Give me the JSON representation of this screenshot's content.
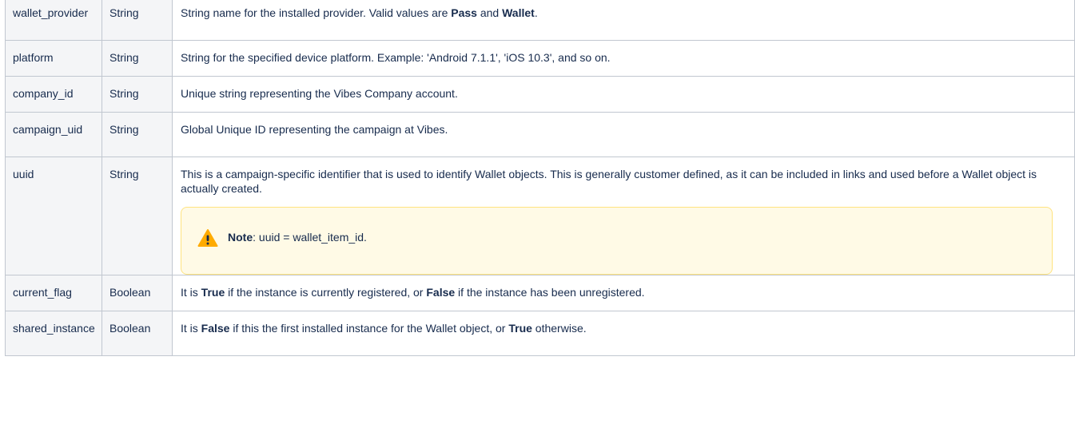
{
  "rows": [
    {
      "name": "wallet_provider",
      "type": "String",
      "desc": [
        {
          "text": "String name for the installed provider. Valid values are "
        },
        {
          "text": "Pass",
          "bold": true
        },
        {
          "text": " and "
        },
        {
          "text": "Wallet",
          "bold": true
        },
        {
          "text": "."
        }
      ]
    },
    {
      "name": "platform",
      "type": "String",
      "desc": [
        {
          "text": "String for the specified device platform. Example: 'Android 7.1.1', 'iOS 10.3', and so on."
        }
      ]
    },
    {
      "name": "company_id",
      "type": "String",
      "desc": [
        {
          "text": "Unique string representing the Vibes Company account."
        }
      ]
    },
    {
      "name": "campaign_uid",
      "type": "String",
      "desc": [
        {
          "text": "Global Unique ID representing the campaign at Vibes."
        }
      ]
    },
    {
      "name": "uuid",
      "type": "String",
      "desc": [
        {
          "text": "This is a campaign-specific identifier that is used to identify Wallet objects. This is generally customer defined, as it can be included in links and used before a Wallet object is actually created."
        }
      ],
      "note": {
        "icon": "warning-icon",
        "label": "Note",
        "text": ": uuid = wallet_item_id."
      }
    },
    {
      "name": "current_flag",
      "type": "Boolean",
      "desc": [
        {
          "text": "It is "
        },
        {
          "text": "True",
          "bold": true
        },
        {
          "text": " if the instance is currently registered, or "
        },
        {
          "text": "False",
          "bold": true
        },
        {
          "text": " if the instance has been unregistered."
        }
      ]
    },
    {
      "name": "shared_instance",
      "type": "Boolean",
      "desc": [
        {
          "text": "It is "
        },
        {
          "text": "False",
          "bold": true
        },
        {
          "text": " if this the first installed instance for the Wallet object, or "
        },
        {
          "text": "True",
          "bold": true
        },
        {
          "text": " otherwise."
        }
      ]
    }
  ],
  "colors": {
    "text": "#172b4d",
    "border": "#c1c7d0",
    "label_cell_bg": "#f4f5f7",
    "note_bg": "#fffae6",
    "note_border": "#ffe380",
    "warning_icon": "#ffab00"
  }
}
